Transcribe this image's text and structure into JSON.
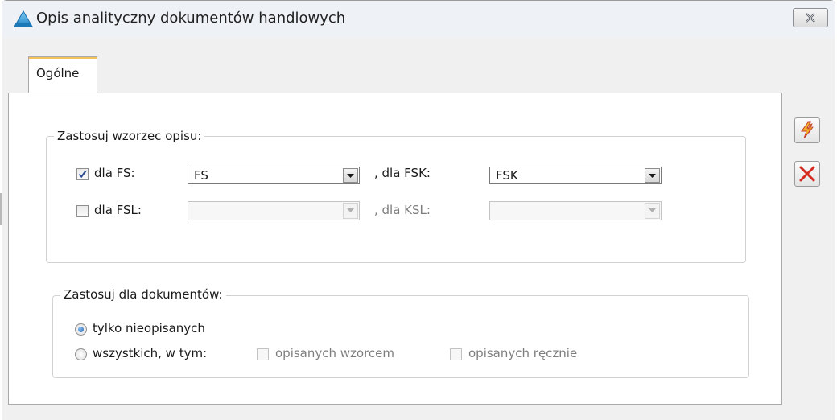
{
  "window": {
    "title": "Opis analityczny dokumentów handlowych"
  },
  "tabs": [
    {
      "label": "Ogólne",
      "active": true
    }
  ],
  "template_group": {
    "title": "Zastosuj wzorzec opisu:",
    "row1": {
      "checkbox_label": "dla FS:",
      "checked": true,
      "combo1_value": "FS",
      "separator_label": ", dla FSK:",
      "combo2_value": "FSK",
      "enabled": true
    },
    "row2": {
      "checkbox_label": "dla FSL:",
      "checked": false,
      "combo1_value": "",
      "separator_label": ", dla KSL:",
      "combo2_value": "",
      "enabled": false
    }
  },
  "documents_group": {
    "title": "Zastosuj dla dokumentów:",
    "option1": {
      "label": "tylko nieopisanych",
      "selected": true
    },
    "option2": {
      "label": "wszystkich, w tym:",
      "selected": false
    },
    "sub_option1": {
      "label": "opisanych wzorcem",
      "checked": false,
      "enabled": false
    },
    "sub_option2": {
      "label": "opisanych ręcznie",
      "checked": false,
      "enabled": false
    }
  },
  "side_buttons": [
    {
      "name": "execute",
      "icon": "lightning-icon"
    },
    {
      "name": "cancel",
      "icon": "close-x-icon"
    }
  ],
  "colors": {
    "tab_accent": "#f3c35a",
    "cancel_icon": "#d42a1f",
    "execute_icon": "#e8a320"
  }
}
